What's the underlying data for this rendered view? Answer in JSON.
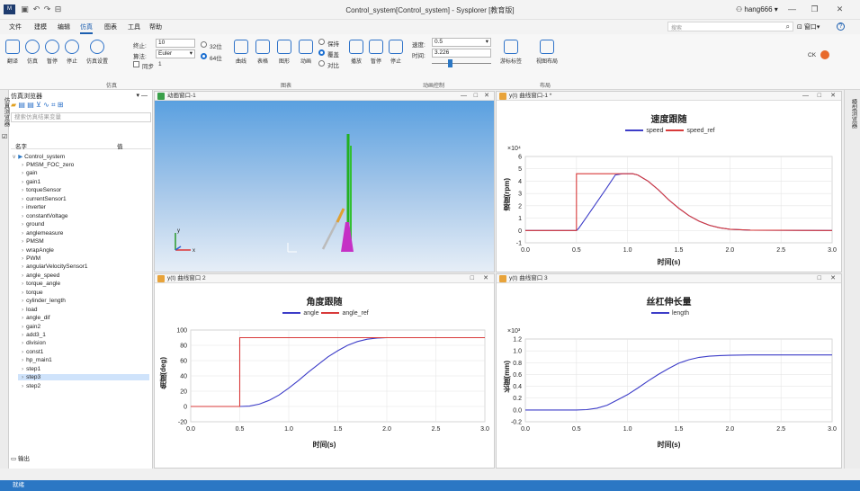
{
  "titlebar": {
    "title": "Control_system[Control_system] - Sysplorer [教育版]",
    "user": "hang666",
    "user_caret": "▾",
    "min": "—",
    "max": "❐",
    "close": "✕"
  },
  "menubar": {
    "items": [
      "文件",
      "建模",
      "编辑",
      "仿真",
      "图表",
      "工具",
      "帮助"
    ],
    "active_index": 3,
    "search_placeholder": "搜索",
    "window_menu": "窗口",
    "window_caret": "▾",
    "help": "?"
  },
  "ribbon": {
    "sim_buttons": [
      "翻译",
      "仿真",
      "暂停",
      "停止",
      "仿真设置"
    ],
    "sim_group": "仿真",
    "stop_time_label": "终止:",
    "stop_time_value": "10",
    "algo_label": "算法:",
    "algo_value": "Euler",
    "algo_caret": "▾",
    "step_label": "同步",
    "step_value": "1",
    "bit32": "32位",
    "bit64": "64位",
    "plot_buttons": [
      "曲线",
      "表格",
      "图形",
      "动画"
    ],
    "plot_radios": [
      "保持",
      "覆盖",
      "对比"
    ],
    "plot_group": "图表",
    "anim_buttons": [
      "播放",
      "暂停",
      "停止"
    ],
    "speed_label": "速度:",
    "speed_value": "0.5",
    "speed_caret": "▾",
    "time_label": "时间:",
    "time_value": "3.226",
    "anim_group": "动画控制",
    "mark_button": "游标标签",
    "layout_button": "视图布局",
    "layout_group": "布局",
    "ck_label": "CK"
  },
  "leftpane": {
    "tab_label": "仿真浏览器",
    "tab2_label": "☑",
    "title": "仿真浏览器",
    "title_controls": "▾ —",
    "search_placeholder": "搜索仿真结果变量",
    "col_name": "名字",
    "col_value": "值",
    "root": "Control_system",
    "items": [
      "PMSM_FOC_zero",
      "gain",
      "gain1",
      "torqueSensor",
      "currentSensor1",
      "inverter",
      "constantVoltage",
      "ground",
      "anglemeasure",
      "PMSM",
      "wrapAngle",
      "PWM",
      "angularVelocitySensor1",
      "angle_speed",
      "torque_angle",
      "torque",
      "cylinder_length",
      "load",
      "angle_dif",
      "gain2",
      "add3_1",
      "division",
      "const1",
      "hp_main1",
      "step1",
      "step3",
      "step2"
    ],
    "selected_index": 25,
    "output_label": "输出"
  },
  "righttab": {
    "label": "模型浏览器"
  },
  "anim_panel": {
    "title": "动画窗口-1",
    "axis_x": "x",
    "axis_y": "y"
  },
  "window_controls": {
    "min": "—",
    "max": "□",
    "close": "✕"
  },
  "plot1": {
    "window": "y(t) 曲线窗口-1 *",
    "title": "速度跟随"
  },
  "plot2": {
    "window": "y(t) 曲线窗口 2",
    "title": "角度跟随"
  },
  "plot3": {
    "window": "y(t) 曲线窗口 3",
    "title": "丝杠伸长量"
  },
  "status": {
    "text": "就绪"
  },
  "colors": {
    "series_blue": "#3d3dc8",
    "series_red": "#d83a3a",
    "accent": "#2b77c4"
  },
  "chart_data": [
    {
      "type": "line",
      "title": "速度跟随",
      "xlabel": "时间(s)",
      "ylabel": "速度(rpm)",
      "xlim": [
        0,
        3
      ],
      "ylim": [
        -1,
        6
      ],
      "y_multiplier": "×10⁴",
      "x_ticks": [
        "0.0",
        "0.5",
        "1.0",
        "1.5",
        "2.0",
        "2.5",
        "3.0"
      ],
      "y_ticks": [
        "-1",
        "0",
        "1",
        "2",
        "3",
        "4",
        "5",
        "6"
      ],
      "series": [
        {
          "name": "speed",
          "color": "#3d3dc8",
          "x": [
            0,
            0.5,
            0.52,
            0.6,
            0.7,
            0.8,
            0.88,
            0.95,
            1.0,
            1.05,
            1.1,
            1.2,
            1.3,
            1.4,
            1.5,
            1.6,
            1.7,
            1.8,
            1.9,
            2.0,
            2.2,
            2.5,
            3.0
          ],
          "y": [
            0,
            0,
            0.15,
            1.1,
            2.3,
            3.5,
            4.5,
            4.6,
            4.6,
            4.6,
            4.5,
            4.0,
            3.3,
            2.5,
            1.8,
            1.2,
            0.75,
            0.42,
            0.22,
            0.1,
            0.03,
            0.01,
            0
          ]
        },
        {
          "name": "speed_ref",
          "color": "#d83a3a",
          "x": [
            0,
            0.5,
            0.5,
            1.05,
            1.1,
            1.2,
            1.3,
            1.4,
            1.5,
            1.6,
            1.7,
            1.8,
            1.9,
            2.0,
            2.2,
            2.5,
            3.0
          ],
          "y": [
            0,
            0,
            4.6,
            4.6,
            4.5,
            4.0,
            3.3,
            2.5,
            1.8,
            1.2,
            0.75,
            0.42,
            0.22,
            0.1,
            0.03,
            0.01,
            0
          ]
        }
      ]
    },
    {
      "type": "line",
      "title": "角度跟随",
      "xlabel": "时间(s)",
      "ylabel": "角度(deg)",
      "xlim": [
        0,
        3
      ],
      "ylim": [
        -20,
        100
      ],
      "x_ticks": [
        "0.0",
        "0.5",
        "1.0",
        "1.5",
        "2.0",
        "2.5",
        "3.0"
      ],
      "y_ticks": [
        "-20",
        "0",
        "20",
        "40",
        "60",
        "80",
        "100"
      ],
      "series": [
        {
          "name": "angle",
          "color": "#3d3dc8",
          "x": [
            0,
            0.5,
            0.6,
            0.7,
            0.8,
            0.9,
            1.0,
            1.1,
            1.2,
            1.3,
            1.4,
            1.5,
            1.6,
            1.7,
            1.8,
            1.9,
            2.0,
            2.2,
            2.5,
            3.0
          ],
          "y": [
            0,
            0,
            0.5,
            3,
            8,
            15,
            24,
            34,
            45,
            55,
            65,
            73,
            80,
            85,
            88,
            89.5,
            90,
            90,
            90,
            90
          ]
        },
        {
          "name": "angle_ref",
          "color": "#d83a3a",
          "x": [
            0,
            0.5,
            0.5,
            3.0
          ],
          "y": [
            0,
            0,
            90,
            90
          ]
        }
      ]
    },
    {
      "type": "line",
      "title": "丝杠伸长量",
      "xlabel": "时间(s)",
      "ylabel": "长度(mm)",
      "xlim": [
        0,
        3
      ],
      "ylim": [
        -0.2,
        1.2
      ],
      "y_multiplier": "×10³",
      "x_ticks": [
        "0.0",
        "0.5",
        "1.0",
        "1.5",
        "2.0",
        "2.5",
        "3.0"
      ],
      "y_ticks": [
        "-0.2",
        "0.0",
        "0.2",
        "0.4",
        "0.6",
        "0.8",
        "1.0",
        "1.2"
      ],
      "series": [
        {
          "name": "length",
          "color": "#3d3dc8",
          "x": [
            0,
            0.5,
            0.6,
            0.7,
            0.8,
            0.9,
            1.0,
            1.1,
            1.2,
            1.3,
            1.4,
            1.5,
            1.6,
            1.7,
            1.8,
            1.9,
            2.0,
            2.2,
            2.5,
            3.0
          ],
          "y": [
            0,
            0,
            0.005,
            0.03,
            0.08,
            0.17,
            0.26,
            0.37,
            0.49,
            0.6,
            0.7,
            0.79,
            0.85,
            0.89,
            0.91,
            0.92,
            0.925,
            0.93,
            0.93,
            0.93
          ]
        }
      ]
    }
  ]
}
